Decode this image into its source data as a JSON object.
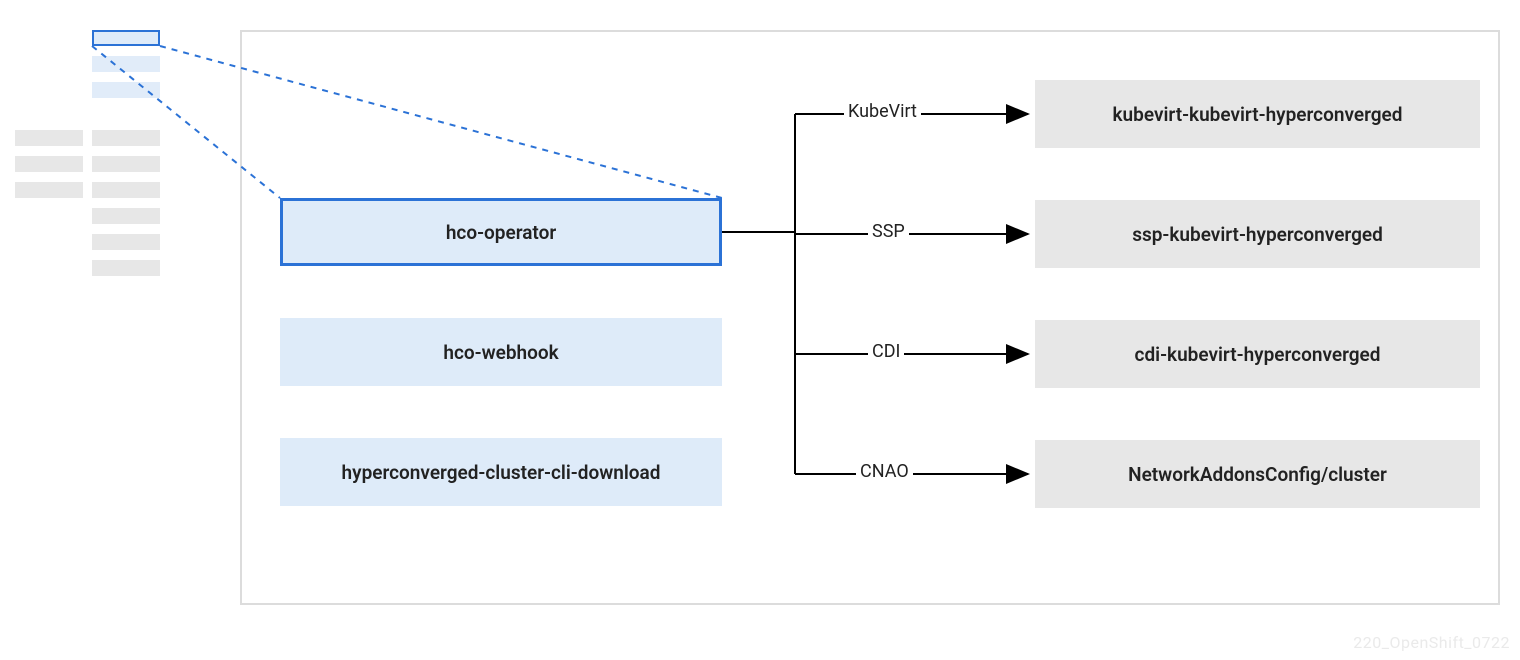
{
  "left_boxes": [
    {
      "label": "hco-operator"
    },
    {
      "label": "hco-webhook"
    },
    {
      "label": "hyperconverged-cluster-cli-download"
    }
  ],
  "right_boxes": [
    {
      "label": "kubevirt-kubevirt-hyperconverged"
    },
    {
      "label": "ssp-kubevirt-hyperconverged"
    },
    {
      "label": "cdi-kubevirt-hyperconverged"
    },
    {
      "label": "NetworkAddonsConfig/cluster"
    }
  ],
  "edges": [
    {
      "label": "KubeVirt"
    },
    {
      "label": "SSP"
    },
    {
      "label": "CDI"
    },
    {
      "label": "CNAO"
    }
  ],
  "watermark": "220_OpenShift_0722"
}
